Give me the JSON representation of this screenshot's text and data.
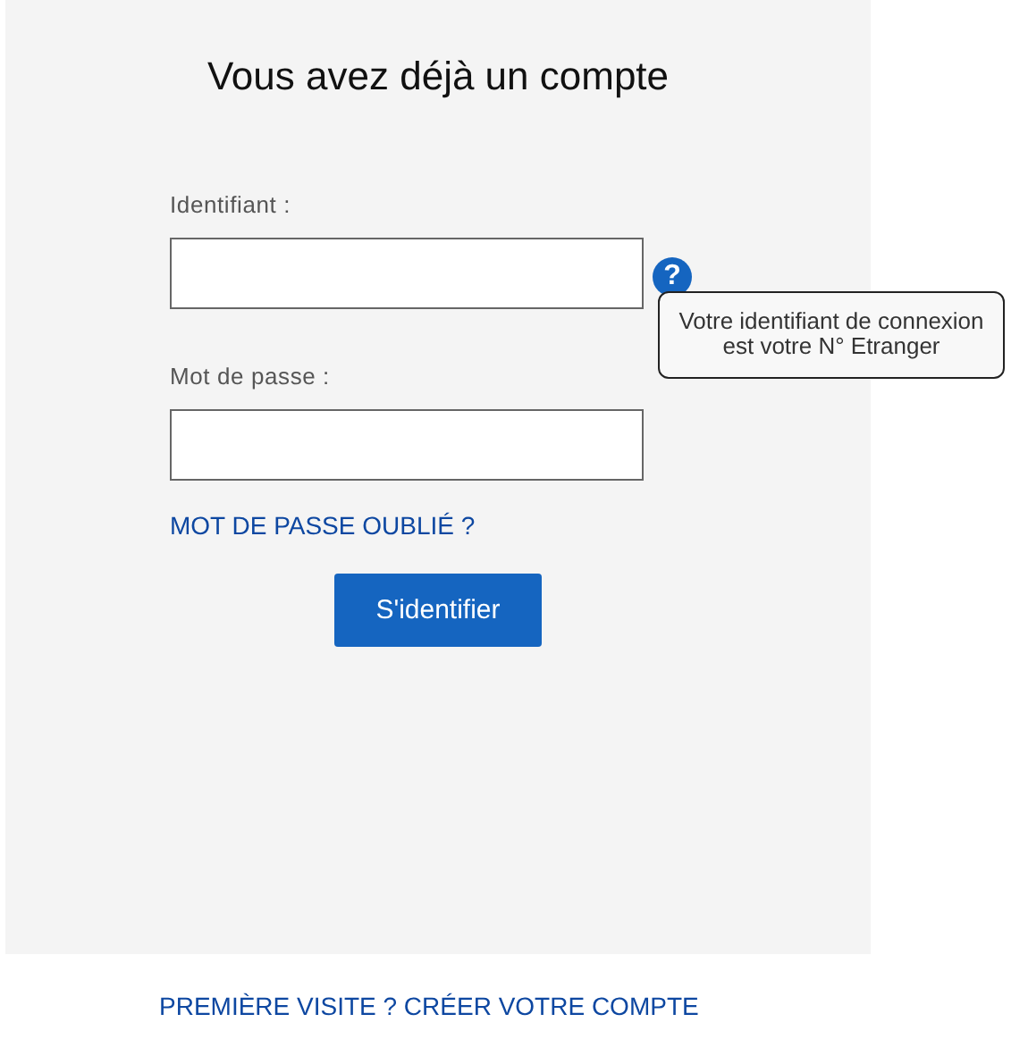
{
  "title": "Vous avez déjà un compte",
  "fields": [
    {
      "label": "Identifiant :",
      "help": "?",
      "tooltip": "Votre identifiant de connexion est votre N° Etranger"
    },
    {
      "label": "Mot de passe :"
    }
  ],
  "forgot_link": "MOT DE PASSE OUBLIÉ ?",
  "submit_button": "S'identifier",
  "signup_link": "PREMIÈRE VISITE ? CRÉER VOTRE COMPTE"
}
